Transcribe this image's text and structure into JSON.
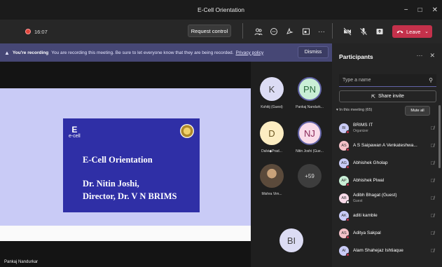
{
  "window": {
    "title": "E-Cell Orientation",
    "controls": [
      "−",
      "□",
      "✕"
    ]
  },
  "toolbar": {
    "timer": "16:07",
    "request_control": "Request control",
    "leave": "Leave",
    "colors": {
      "leave_bg": "#c4314b",
      "accent": "#6264a7"
    }
  },
  "banner": {
    "bold": "You're recording",
    "text": "You are recording this meeting. Be sure to let everyone know that they are being recorded.",
    "link": "Privacy policy",
    "dismiss": "Dismiss"
  },
  "slide": {
    "logo_text": "e-cell",
    "title": "E-Cell Orientation",
    "line1": "Dr. Nitin Joshi,",
    "line2": "Director, Dr. V N BRIMS"
  },
  "presenter_name": "Pankaj Nandurkar",
  "gallery": [
    {
      "initials": "K",
      "name": "Kshitij (Guest)",
      "bg": "#dcdcf4",
      "fg": "#444"
    },
    {
      "initials": "PN",
      "name": "Pankaj Nandurk...",
      "bg": "#c9efd6",
      "fg": "#2a6a3f"
    },
    {
      "initials": "D",
      "name": "Dalvi◆Prad...",
      "bg": "#fcedc2",
      "fg": "#6a5520"
    },
    {
      "initials": "NJ",
      "name": "Nitin Joshi (Gue...",
      "bg": "#f9dbe9",
      "fg": "#8a2a5a"
    },
    {
      "initials": "",
      "name": "Mishra Vim...",
      "bg": "#5b4a3b",
      "fg": "#fff"
    },
    {
      "initials": "+59",
      "name": "",
      "bg": "#3d3d3d",
      "fg": "#ddd"
    },
    {
      "initials": "BI",
      "name": "",
      "bg": "#dcdcf4",
      "fg": "#444"
    }
  ],
  "participants": {
    "header": "Participants",
    "search_placeholder": "Type a name",
    "share_invite": "Share invite",
    "in_meeting": "In this meeting (65)",
    "mute_all": "Mute all",
    "list": [
      {
        "initials": "BI",
        "name": "BRIMS IT",
        "sub": "Organizer",
        "bg": "#c9cbf6"
      },
      {
        "initials": "AS",
        "name": "A S Saipawan A Venkateshwa...",
        "sub": "",
        "bg": "#f3c1c8"
      },
      {
        "initials": "AG",
        "name": "Abhishek Gholap",
        "sub": "",
        "bg": "#c9cbf6"
      },
      {
        "initials": "AP",
        "name": "Abhishek Piwal",
        "sub": "",
        "bg": "#c9efd6"
      },
      {
        "initials": "AB",
        "name": "Adibh Bhagat (Guest)",
        "sub": "Guest",
        "bg": "#f9dbe9"
      },
      {
        "initials": "AK",
        "name": "aditi kamble",
        "sub": "",
        "bg": "#c9cbf6"
      },
      {
        "initials": "AS",
        "name": "Aditya Sakpal",
        "sub": "",
        "bg": "#f3c1c8"
      },
      {
        "initials": "AI",
        "name": "Alam Shahejaz Ishtiaque",
        "sub": "",
        "bg": "#c9cbf6"
      }
    ]
  }
}
